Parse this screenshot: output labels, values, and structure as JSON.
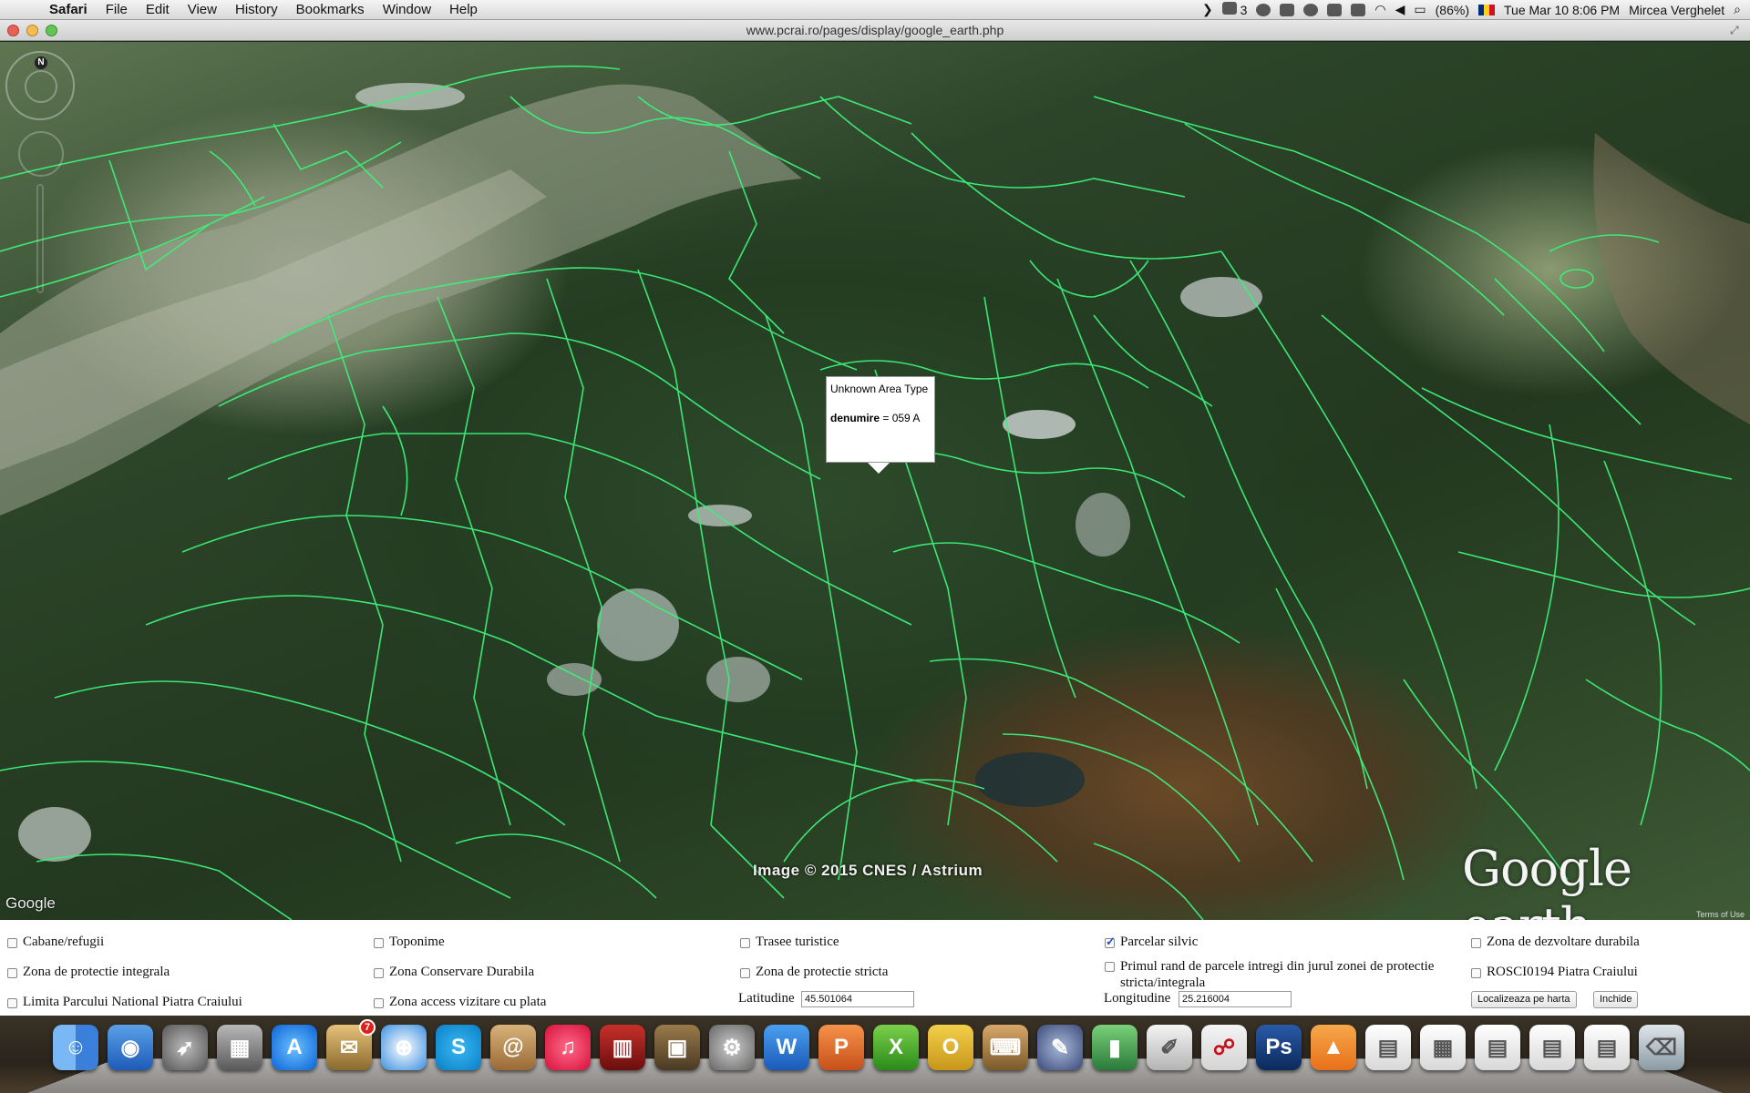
{
  "menubar": {
    "app": "Safari",
    "items": [
      "File",
      "Edit",
      "View",
      "History",
      "Bookmarks",
      "Window",
      "Help"
    ],
    "adobe_count": "3",
    "battery": "(86%)",
    "datetime": "Tue Mar 10  8:06 PM",
    "user": "Mircea Verghelet"
  },
  "window": {
    "url": "www.pcrai.ro/pages/display/google_earth.php"
  },
  "map": {
    "compass_label": "N",
    "balloon": {
      "title": "Unknown Area Type",
      "key": "denumire",
      "value": "= 059 A"
    },
    "copyright": "Image © 2015 CNES / Astrium",
    "logo": "Google earth",
    "google_small": "Google",
    "terms": "Terms of Use",
    "overlay_color": "#3df07a"
  },
  "layers": {
    "cabane": {
      "label": "Cabane/refugii",
      "checked": false
    },
    "toponime": {
      "label": "Toponime",
      "checked": false
    },
    "trasee": {
      "label": "Trasee turistice",
      "checked": false
    },
    "parcelar": {
      "label": "Parcelar silvic",
      "checked": true
    },
    "dezvoltare": {
      "label": "Zona de dezvoltare durabila",
      "checked": false
    },
    "protectie_integrala": {
      "label": "Zona de protectie integrala",
      "checked": false
    },
    "conservare": {
      "label": "Zona Conservare Durabila",
      "checked": false
    },
    "protectie_stricta": {
      "label": "Zona de protectie stricta",
      "checked": false
    },
    "primul_rand": {
      "label": "Primul rand de parcele intregi din jurul zonei de protectie stricta/integrala",
      "checked": false
    },
    "rosci": {
      "label": "ROSCI0194 Piatra Craiului",
      "checked": false
    },
    "limita": {
      "label": "Limita Parcului National Piatra Craiului",
      "checked": false
    },
    "access": {
      "label": "Zona access vizitare cu plata",
      "checked": false
    }
  },
  "coords": {
    "lat_label": "Latitudine",
    "lat_value": "45.501064",
    "lon_label": "Longitudine",
    "lon_value": "25.216004"
  },
  "buttons": {
    "locate": "Localizeaza pe harta",
    "close": "Inchide"
  },
  "dock": {
    "icons": [
      "finder-icon",
      "dashboard-icon",
      "launchpad-icon",
      "photo-browser-icon",
      "app-store-icon",
      "mail-icon",
      "safari-icon",
      "skype-icon",
      "contacts-icon",
      "itunes-icon",
      "photo-booth-icon",
      "preview-icon",
      "system-preferences-icon",
      "word-icon",
      "powerpoint-icon",
      "excel-icon",
      "outlook-icon",
      "keynote-icon",
      "xcode-icon",
      "numbers-icon",
      "script-editor-icon",
      "acrobat-icon",
      "photoshop-icon",
      "vlc-icon",
      "document-icon",
      "spreadsheet-icon",
      "word-doc-icon",
      "word-doc-2-icon",
      "word-doc-3-icon",
      "trash-icon"
    ],
    "mail_badge": "7"
  }
}
